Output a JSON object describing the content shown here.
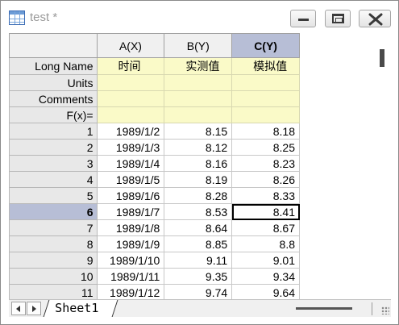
{
  "window": {
    "title": "test *",
    "icons": {
      "app": "worksheet-grid-icon",
      "minimize": "minimize-icon",
      "maximize": "maximize-icon",
      "close": "close-icon"
    }
  },
  "columns": [
    {
      "header": "A(X)",
      "long_name": "时间"
    },
    {
      "header": "B(Y)",
      "long_name": "实测值"
    },
    {
      "header": "C(Y)",
      "long_name": "模拟值"
    }
  ],
  "meta_labels": {
    "long_name": "Long Name",
    "units": "Units",
    "comments": "Comments",
    "fx": "F(x)="
  },
  "rows": [
    {
      "n": "1",
      "a": "1989/1/2",
      "b": "8.15",
      "c": "8.18"
    },
    {
      "n": "2",
      "a": "1989/1/3",
      "b": "8.12",
      "c": "8.25"
    },
    {
      "n": "3",
      "a": "1989/1/4",
      "b": "8.16",
      "c": "8.23"
    },
    {
      "n": "4",
      "a": "1989/1/5",
      "b": "8.19",
      "c": "8.26"
    },
    {
      "n": "5",
      "a": "1989/1/6",
      "b": "8.28",
      "c": "8.33"
    },
    {
      "n": "6",
      "a": "1989/1/7",
      "b": "8.53",
      "c": "8.41"
    },
    {
      "n": "7",
      "a": "1989/1/8",
      "b": "8.64",
      "c": "8.67"
    },
    {
      "n": "8",
      "a": "1989/1/9",
      "b": "8.85",
      "c": "8.8"
    },
    {
      "n": "9",
      "a": "1989/1/10",
      "b": "9.11",
      "c": "9.01"
    },
    {
      "n": "10",
      "a": "1989/1/11",
      "b": "9.35",
      "c": "9.34"
    },
    {
      "n": "11",
      "a": "1989/1/12",
      "b": "9.74",
      "c": "9.64"
    }
  ],
  "selection": {
    "selected_column": "C(Y)",
    "selected_row": "6",
    "active_cell": "8.41"
  },
  "sheet_tabs": [
    "Sheet1"
  ],
  "colors": {
    "meta_row_bg": "#fafac8",
    "selection_bg": "#b7bed6",
    "header_bg": "#f0f0f0"
  }
}
